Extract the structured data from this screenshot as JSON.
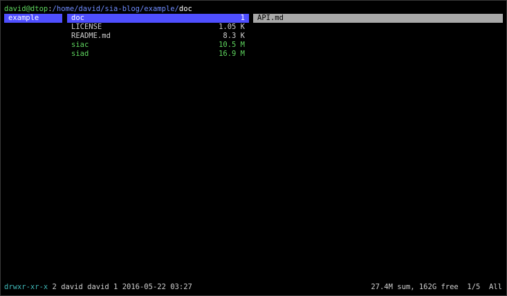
{
  "titlebar": {
    "user_host": "david@dtop",
    "colon": ":",
    "path": "/home/david/sia-blog/example/",
    "current": "doc"
  },
  "parent_column": {
    "items": [
      {
        "name": "example",
        "selected": true
      }
    ]
  },
  "current_column": {
    "items": [
      {
        "name": "doc",
        "size": "1",
        "selected": true,
        "kind": "dir"
      },
      {
        "name": "LICENSE",
        "size": "1.05 K",
        "selected": false,
        "kind": "file"
      },
      {
        "name": "README.md",
        "size": "8.3 K",
        "selected": false,
        "kind": "file"
      },
      {
        "name": "siac",
        "size": "10.5 M",
        "selected": false,
        "kind": "exec"
      },
      {
        "name": "siad",
        "size": "16.9 M",
        "selected": false,
        "kind": "exec"
      }
    ]
  },
  "preview_column": {
    "items": [
      {
        "name": "API.md",
        "selected": true
      }
    ]
  },
  "statusbar": {
    "permissions": "drwxr-xr-x",
    "info": "2 david david 1 2016-05-22 03:27",
    "disk": "27.4M sum, 162G free",
    "position": "1/5",
    "scroll": "All"
  },
  "colors": {
    "background": "#000000",
    "selection": "#4f4fff",
    "preview_selection": "#a8a8a8",
    "user_host": "#5fd75f",
    "path": "#6f8cff",
    "executable": "#5fd75f",
    "permissions": "#3fb8b8"
  }
}
